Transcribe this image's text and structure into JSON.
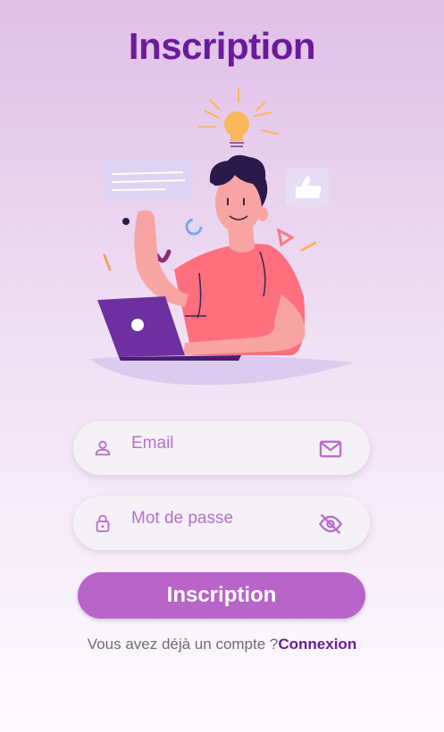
{
  "header": {
    "title": "Inscription"
  },
  "form": {
    "email": {
      "placeholder": "Email",
      "lead_icon": "person-icon",
      "trail_icon": "mail-icon"
    },
    "password": {
      "placeholder": "Mot de passe",
      "lead_icon": "lock-icon",
      "trail_icon": "eye-off-icon"
    },
    "submit_label": "Inscription"
  },
  "footer": {
    "prompt": "Vous avez déjà un compte ?",
    "link_label": "Connexion"
  },
  "colors": {
    "accent": "#6a1b9a",
    "button": "#b964c8",
    "icon": "#b86fcc"
  }
}
